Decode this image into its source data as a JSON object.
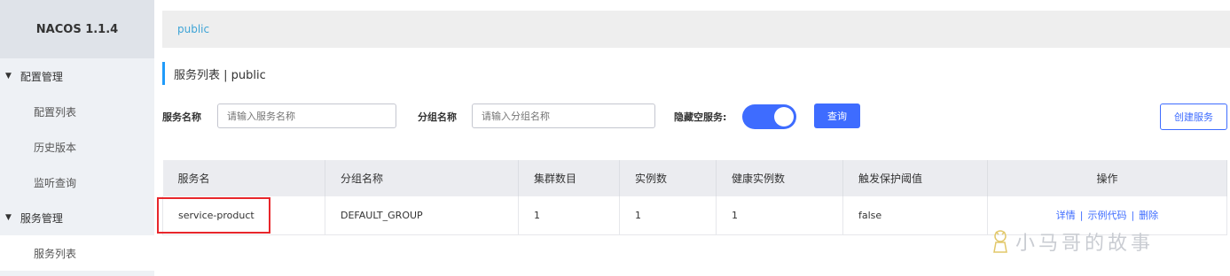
{
  "sidebar": {
    "logo": "NACOS 1.1.4",
    "groups": [
      {
        "label": "配置管理",
        "items": [
          "配置列表",
          "历史版本",
          "监听查询"
        ]
      },
      {
        "label": "服务管理",
        "items": [
          "服务列表"
        ]
      }
    ]
  },
  "topbar": {
    "namespace": "public"
  },
  "page": {
    "title": "服务列表 | public"
  },
  "filters": {
    "service_name_label": "服务名称",
    "service_name_placeholder": "请输入服务名称",
    "group_name_label": "分组名称",
    "group_name_placeholder": "请输入分组名称",
    "hide_empty_label": "隐藏空服务:",
    "hide_empty_on": true,
    "query_label": "查询",
    "create_label": "创建服务"
  },
  "table": {
    "columns": [
      "服务名",
      "分组名称",
      "集群数目",
      "实例数",
      "健康实例数",
      "触发保护阈值",
      "操作"
    ],
    "rows": [
      {
        "service": "service-product",
        "group": "DEFAULT_GROUP",
        "clusters": "1",
        "instances": "1",
        "healthy": "1",
        "threshold": "false",
        "actions": [
          "详情",
          "示例代码",
          "删除"
        ]
      }
    ]
  },
  "watermark": "小马哥的故事",
  "colors": {
    "accent": "#3e6cff",
    "highlight": "#e8262b",
    "link": "#3ea4d6"
  }
}
